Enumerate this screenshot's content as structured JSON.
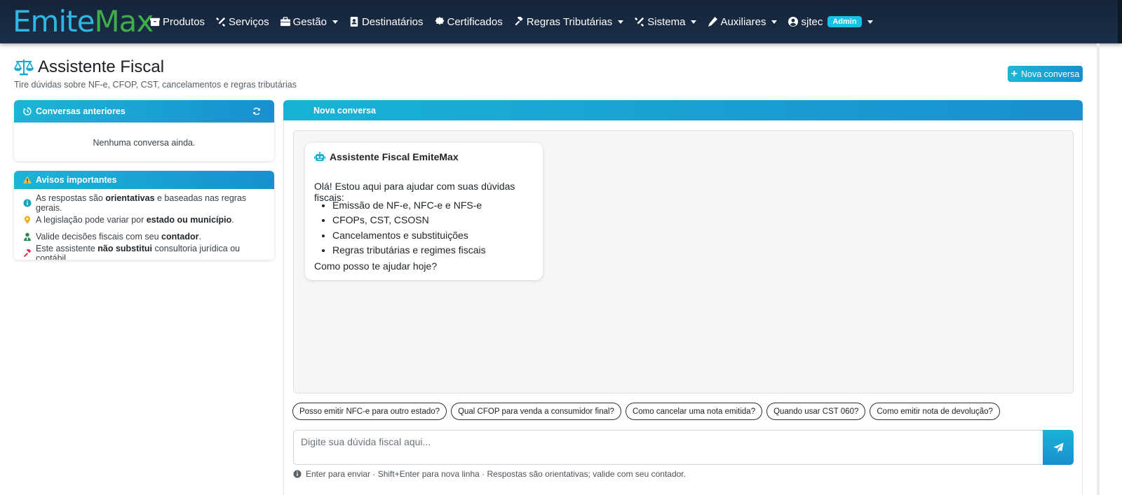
{
  "app": {
    "brand_part1": "Emite",
    "brand_part2": "Max"
  },
  "navbar": {
    "items": [
      {
        "label": "Produtos",
        "icon": "box-icon"
      },
      {
        "label": "Serviços",
        "icon": "tools-icon"
      },
      {
        "label": "Gestão",
        "icon": "briefcase-icon",
        "dropdown": true
      },
      {
        "label": "Destinatários",
        "icon": "address-book-icon"
      },
      {
        "label": "Certificados",
        "icon": "certificate-icon"
      },
      {
        "label": "Regras Tributárias",
        "icon": "gavel-icon",
        "dropdown": true
      },
      {
        "label": "Sistema",
        "icon": "tools-icon",
        "dropdown": true
      },
      {
        "label": "Auxiliares",
        "icon": "pencil-icon",
        "dropdown": true
      }
    ],
    "user": {
      "name": "sjtec",
      "role_badge": "Admin",
      "icon": "user-circle-icon"
    }
  },
  "header": {
    "title": "Assistente Fiscal",
    "subtitle": "Tire dúvidas sobre NF-e, CFOP, CST, cancelamentos e regras tributárias",
    "new_button": "Nova conversa"
  },
  "conversations": {
    "title": "Conversas anteriores",
    "empty": "Nenhuma conversa ainda."
  },
  "avisos": {
    "title": "Avisos importantes",
    "items": [
      {
        "pre": "As respostas são ",
        "bold": "orientativas",
        "post": " e baseadas nas regras gerais.",
        "color": "#17a2b8"
      },
      {
        "pre": "A legislação pode variar por ",
        "bold": "estado ou município",
        "post": ".",
        "color": "#f0ad1e"
      },
      {
        "pre": "Valide decisões fiscais com seu ",
        "bold": "contador",
        "post": ".",
        "color": "#2e8b57"
      },
      {
        "pre": "Este assistente ",
        "bold": "não substitui",
        "post": " consultoria jurídica ou contábil.",
        "color": "#d9304a"
      }
    ]
  },
  "chat": {
    "header": "Nova conversa",
    "assistant_name": "Assistente Fiscal EmiteMax",
    "intro": "Olá! Estou aqui para ajudar com suas dúvidas fiscais:",
    "topics": [
      "Emissão de NF-e, NFC-e e NFS-e",
      "CFOPs, CST, CSOSN",
      "Cancelamentos e substituições",
      "Regras tributárias e regimes fiscais"
    ],
    "outro": "Como posso te ajudar hoje?",
    "suggestions": [
      "Posso emitir NFC-e para outro estado?",
      "Qual CFOP para venda a consumidor final?",
      "Como cancelar uma nota emitida?",
      "Quando usar CST 060?",
      "Como emitir nota de devolução?"
    ],
    "input_placeholder": "Digite sua dúvida fiscal aqui...",
    "hint": "Enter para enviar · Shift+Enter para nova linha · Respostas são orientativas; valide com seu contador."
  },
  "colors": {
    "navbar": "#142338",
    "accent_start": "#1cb5d6",
    "accent_end": "#1790cf",
    "badge": "#17c1e8"
  }
}
